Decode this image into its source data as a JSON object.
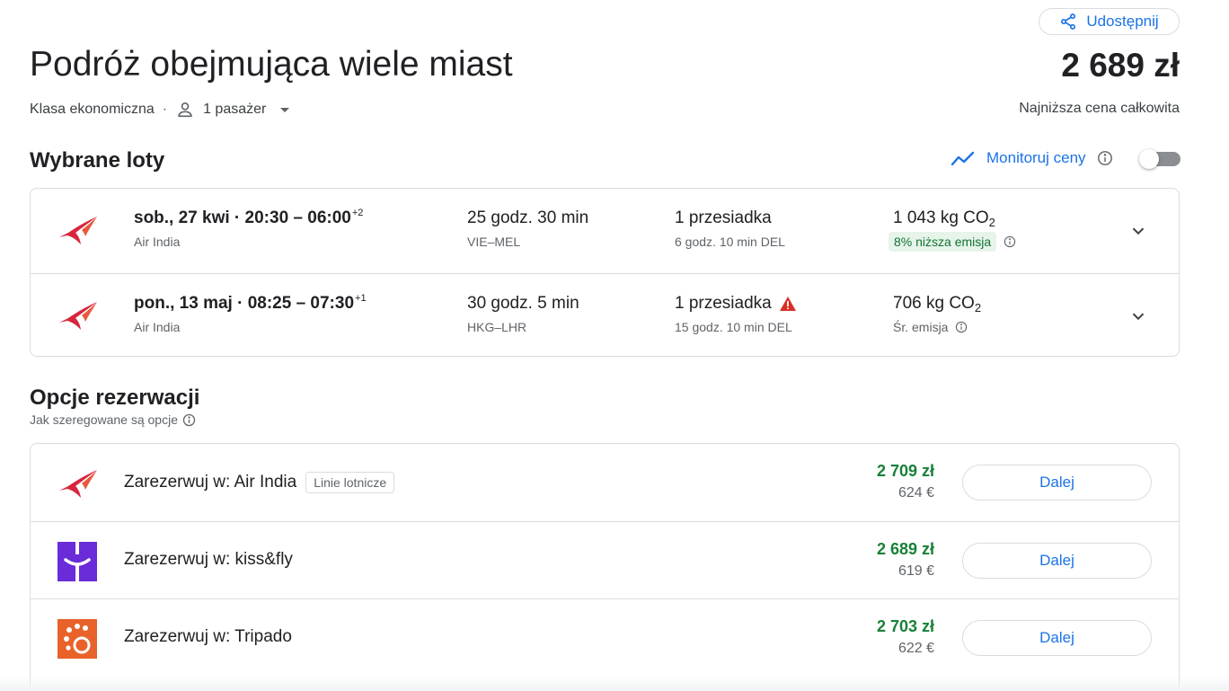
{
  "header": {
    "share_label": "Udostępnij",
    "title": "Podróż obejmująca wiele miast",
    "total_price": "2 689 zł",
    "cabin_class": "Klasa ekonomiczna",
    "separator": "·",
    "passengers": "1 pasażer",
    "lowest_price_label": "Najniższa cena całkowita"
  },
  "selected": {
    "title": "Wybrane loty",
    "monitor_label": "Monitoruj ceny",
    "monitor_on": false
  },
  "flights": [
    {
      "date_time": "sob., 27 kwi  ·  20:30 – 06:00",
      "day_offset": "+2",
      "airline": "Air India",
      "duration": "25 godz. 30 min",
      "route": "VIE–MEL",
      "stops": "1 przesiadka",
      "layover": "6 godz. 10 min DEL",
      "co2": "1 043 kg CO",
      "co2_sub": "2",
      "emission_note": "8% niższa emisja",
      "warning": false
    },
    {
      "date_time": "pon., 13 maj  ·  08:25 – 07:30",
      "day_offset": "+1",
      "airline": "Air India",
      "duration": "30 godz. 5 min",
      "route": "HKG–LHR",
      "stops": "1 przesiadka",
      "layover": "15 godz. 10 min DEL",
      "co2": "706 kg CO",
      "co2_sub": "2",
      "emission_note": "Śr. emisja",
      "warning": true
    }
  ],
  "booking": {
    "title": "Opcje rezerwacji",
    "ranking_label": "Jak szeregowane są opcje",
    "options": [
      {
        "label": "Zarezerwuj w: Air India",
        "chip": "Linie lotnicze",
        "price_pln": "2 709 zł",
        "price_eur": "624 €",
        "button": "Dalej",
        "logo": "air-india-logo"
      },
      {
        "label": "Zarezerwuj w: kiss&fly",
        "chip": "",
        "price_pln": "2 689 zł",
        "price_eur": "619 €",
        "button": "Dalej",
        "logo": "kissfly-logo"
      },
      {
        "label": "Zarezerwuj w: Tripado",
        "chip": "",
        "price_pln": "2 703 zł",
        "price_eur": "622 €",
        "button": "Dalej",
        "logo": "tripado-logo"
      }
    ]
  },
  "colors": {
    "accent": "#1a73e8",
    "price_green": "#188038",
    "air_india_red": "#d7263d",
    "kissfly_purple": "#6a2bd9",
    "tripado_orange": "#e8622a",
    "warning_red": "#d93025"
  }
}
